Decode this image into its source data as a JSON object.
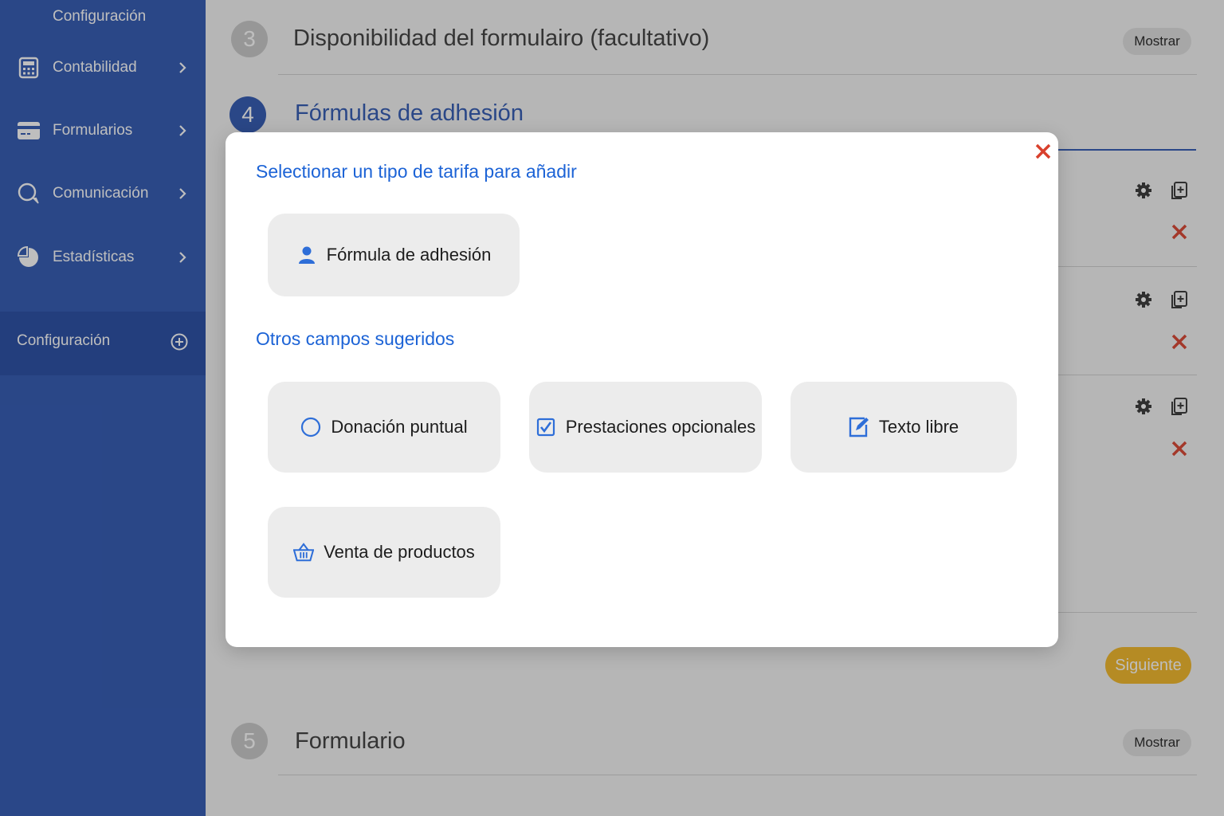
{
  "sidebar": {
    "top_label": "Configuración",
    "items": [
      {
        "label": "Contabilidad",
        "icon": "calculator-icon"
      },
      {
        "label": "Formularios",
        "icon": "card-icon"
      },
      {
        "label": "Comunicación",
        "icon": "chat-icon"
      },
      {
        "label": "Estadísticas",
        "icon": "pie-chart-icon"
      }
    ],
    "active_item": {
      "label": "Configuración",
      "icon": "plus-circle-icon"
    }
  },
  "steps": [
    {
      "number": "3",
      "title": "Disponibilidad del formulairo (facultativo)",
      "button": "Mostrar"
    },
    {
      "number": "4",
      "title": "Fórmulas de adhesión"
    },
    {
      "number": "5",
      "title": "Formulario",
      "button": "Mostrar"
    }
  ],
  "next_button": "Siguiente",
  "modal": {
    "title": "Selectionar un tipo de tarifa para añadir",
    "primary_option": {
      "label": "Fórmula de adhesión",
      "icon": "user-icon"
    },
    "suggested_title": "Otros campos sugeridos",
    "suggested_options": [
      {
        "label": "Donación puntual",
        "icon": "radio-circle-icon"
      },
      {
        "label": "Prestaciones opcionales",
        "icon": "checkbox-icon"
      },
      {
        "label": "Texto libre",
        "icon": "edit-icon"
      },
      {
        "label": "Venta de productos",
        "icon": "basket-icon"
      }
    ]
  },
  "colors": {
    "sidebar": "#2b55b1",
    "accent_blue": "#1c63d6",
    "close_red": "#d9402c",
    "next_yellow": "#f2b623"
  }
}
